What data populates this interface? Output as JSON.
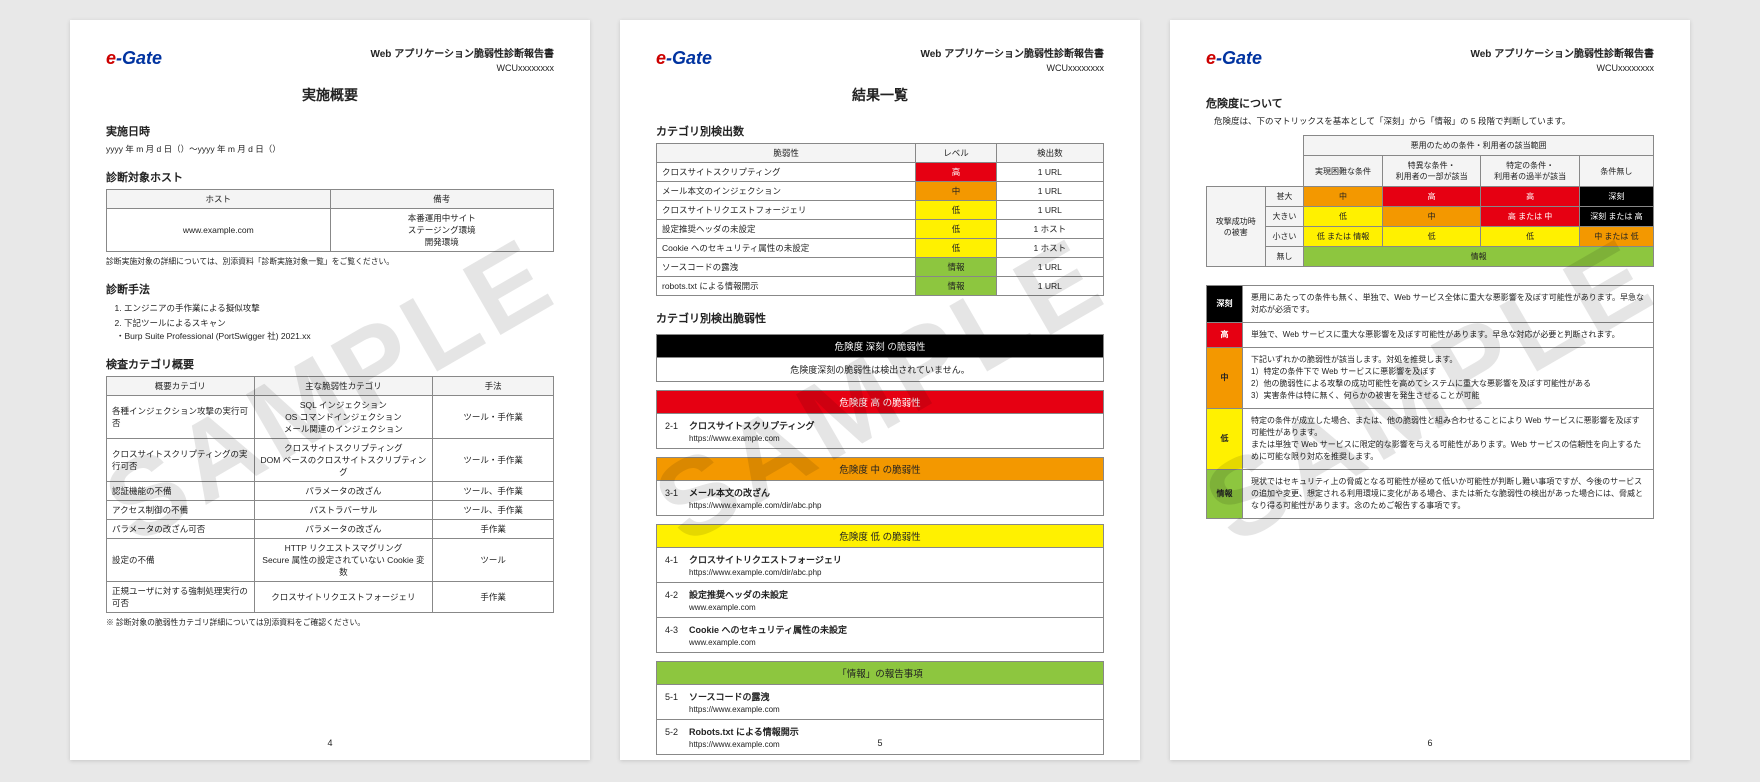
{
  "watermark": "SAMPLE",
  "logo": {
    "e": "e",
    "rest": "-Gate"
  },
  "doc": {
    "title": "Web アプリケーション脆弱性診断報告書",
    "id": "WCUxxxxxxxx"
  },
  "page1": {
    "section": "実施概要",
    "dt_h": "実施日時",
    "dt_v": "yyyy 年 m 月 d 日（）～yyyy 年 m 月 d 日（）",
    "hosts_h": "診断対象ホスト",
    "hosts_th": {
      "host": "ホスト",
      "note": "備考"
    },
    "hosts": [
      {
        "host": "www.example.com",
        "note": "本番運用中サイト\nステージング環境\n開発環境"
      }
    ],
    "hosts_note": "診断実施対象の詳細については、別添資料「診断実施対象一覧」をご覧ください。",
    "method_h": "診断手法",
    "methods": [
      "エンジニアの手作業による擬似攻撃",
      "下記ツールによるスキャン"
    ],
    "method_tool": "Burp Suite Professional (PortSwigger 社) 2021.xx",
    "catsum_h": "検査カテゴリ概要",
    "cat_th": {
      "a": "概要カテゴリ",
      "b": "主な脆弱性カテゴリ",
      "c": "手法"
    },
    "cats": [
      {
        "a": "各種インジェクション攻撃の実行可否",
        "b": "SQL インジェクション\nOS コマンドインジェクション\nメール関連のインジェクション",
        "c": "ツール・手作業"
      },
      {
        "a": "クロスサイトスクリプティングの実行可否",
        "b": "クロスサイトスクリプティング\nDOM ベースのクロスサイトスクリプティング",
        "c": "ツール・手作業"
      },
      {
        "a": "認証機能の不備",
        "b": "パラメータの改ざん",
        "c": "ツール、手作業"
      },
      {
        "a": "アクセス制御の不備",
        "b": "パストラバーサル",
        "c": "ツール、手作業"
      },
      {
        "a": "パラメータの改ざん可否",
        "b": "パラメータの改ざん",
        "c": "手作業"
      },
      {
        "a": "設定の不備",
        "b": "HTTP リクエストスマグリング\nSecure 属性の設定されていない Cookie 変数",
        "c": "ツール"
      },
      {
        "a": "正規ユーザに対する強制処理実行の可否",
        "b": "クロスサイトリクエストフォージェリ",
        "c": "手作業"
      }
    ],
    "cat_note": "※ 診断対象の脆弱性カテゴリ詳細については別添資料をご確認ください。",
    "pagenum": "4"
  },
  "page2": {
    "section": "結果一覧",
    "catcount_h": "カテゴリ別検出数",
    "th": {
      "v": "脆弱性",
      "lv": "レベル",
      "n": "検出数"
    },
    "rows": [
      {
        "v": "クロスサイトスクリプティング",
        "lv": "高",
        "cls": "sev-h",
        "n": "1 URL"
      },
      {
        "v": "メール本文のインジェクション",
        "lv": "中",
        "cls": "sev-m",
        "n": "1 URL"
      },
      {
        "v": "クロスサイトリクエストフォージェリ",
        "lv": "低",
        "cls": "sev-l",
        "n": "1 URL"
      },
      {
        "v": "設定推奨ヘッダの未設定",
        "lv": "低",
        "cls": "sev-l",
        "n": "1 ホスト"
      },
      {
        "v": "Cookie へのセキュリティ属性の未設定",
        "lv": "低",
        "cls": "sev-l",
        "n": "1 ホスト"
      },
      {
        "v": "ソースコードの露洩",
        "lv": "情報",
        "cls": "sev-i",
        "n": "1 URL"
      },
      {
        "v": "robots.txt による情報開示",
        "lv": "情報",
        "cls": "sev-i",
        "n": "1 URL"
      }
    ],
    "findings_h": "カテゴリ別検出脆弱性",
    "bands": {
      "critical": {
        "title": "危険度 深刻 の脆弱性",
        "empty": "危険度深刻の脆弱性は検出されていません。"
      },
      "high": {
        "title": "危険度 高 の脆弱性",
        "items": [
          {
            "n": "2-1",
            "t": "クロスサイトスクリプティング",
            "u": "https://www.example.com"
          }
        ]
      },
      "medium": {
        "title": "危険度 中 の脆弱性",
        "items": [
          {
            "n": "3-1",
            "t": "メール本文の改ざん",
            "u": "https://www.example.com/dir/abc.php"
          }
        ]
      },
      "low": {
        "title": "危険度 低 の脆弱性",
        "items": [
          {
            "n": "4-1",
            "t": "クロスサイトリクエストフォージェリ",
            "u": "https://www.example.com/dir/abc.php"
          },
          {
            "n": "4-2",
            "t": "設定推奨ヘッダの未設定",
            "u": "www.example.com"
          },
          {
            "n": "4-3",
            "t": "Cookie へのセキュリティ属性の未設定",
            "u": "www.example.com"
          }
        ]
      },
      "info": {
        "title": "「情報」の報告事項",
        "items": [
          {
            "n": "5-1",
            "t": "ソースコードの露洩",
            "u": "https://www.example.com"
          },
          {
            "n": "5-2",
            "t": "Robots.txt による情報開示",
            "u": "https://www.example.com"
          }
        ]
      }
    },
    "pagenum": "5"
  },
  "page3": {
    "about_h": "危険度について",
    "about_txt": "危険度は、下のマトリックスを基本として「深刻」から「情報」の 5 段階で判断しています。",
    "matrix_title": "悪用のための条件・利用者の該当範囲",
    "matrix_cols": [
      "実現困難な条件",
      "特異な条件・\n利用者の一部が該当",
      "特定の条件・\n利用者の過半が該当",
      "条件無し"
    ],
    "matrix_side_title": "攻撃成功時\nの被害",
    "matrix_rows_h": [
      "甚大",
      "大きい",
      "小さい",
      "無し"
    ],
    "matrix": [
      [
        {
          "t": "中",
          "c": "sev-m"
        },
        {
          "t": "高",
          "c": "sev-h"
        },
        {
          "t": "高",
          "c": "sev-h"
        },
        {
          "t": "深刻",
          "c": "sev-c"
        }
      ],
      [
        {
          "t": "低",
          "c": "sev-l"
        },
        {
          "t": "中",
          "c": "sev-m"
        },
        {
          "t": "高 または 中",
          "c": "sev-h"
        },
        {
          "t": "深刻 または 高",
          "c": "sev-c"
        }
      ],
      [
        {
          "t": "低 または 情報",
          "c": "sev-l"
        },
        {
          "t": "低",
          "c": "sev-l"
        },
        {
          "t": "低",
          "c": "sev-l"
        },
        {
          "t": "中 または 低",
          "c": "sev-m"
        }
      ],
      [
        {
          "t": "情報",
          "c": "sev-i",
          "span": 4
        }
      ]
    ],
    "levels": [
      {
        "lab": "深刻",
        "cls": "lab-c",
        "txt": "悪用にあたっての条件も無く、単独で、Web サービス全体に重大な悪影響を及ぼす可能性があります。早急な対応が必須です。"
      },
      {
        "lab": "高",
        "cls": "lab-h",
        "txt": "単独で、Web サービスに重大な悪影響を及ぼす可能性があります。早急な対応が必要と判断されます。"
      },
      {
        "lab": "中",
        "cls": "lab-m",
        "txt": "下記いずれかの脆弱性が該当します。対処を推奨します。\n1）特定の条件下で Web サービスに悪影響を及ぼす\n2）他の脆弱性による攻撃の成功可能性を高めてシステムに重大な悪影響を及ぼす可能性がある\n3）実害条件は特に無く、何らかの被害を発生させることが可能"
      },
      {
        "lab": "低",
        "cls": "lab-l",
        "txt": "特定の条件が成立した場合、または、他の脆弱性と組み合わせることにより Web サービスに悪影響を及ぼす可能性があります。\nまたは単独で Web サービスに限定的な影響を与える可能性があります。Web サービスの信頼性を向上するために可能な限り対応を推奨します。"
      },
      {
        "lab": "情報",
        "cls": "lab-i",
        "txt": "現状ではセキュリティ上の脅威となる可能性が極めて低いか可能性が判断し難い事項ですが、今後のサービスの追加や変更、想定される利用環境に変化がある場合、または新たな脆弱性の検出があった場合には、脅威となり得る可能性があります。念のためご報告する事項です。"
      }
    ],
    "pagenum": "6"
  }
}
